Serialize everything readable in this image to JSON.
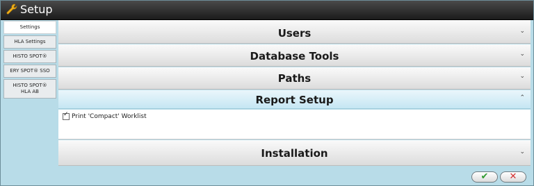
{
  "window": {
    "title": "Setup",
    "icon": "wrench-icon"
  },
  "tabs": [
    {
      "label": "Settings",
      "active": true
    },
    {
      "label": "HLA Settings",
      "active": false
    },
    {
      "label": "HISTO SPOT®",
      "active": false
    },
    {
      "label": "ERY SPOT® SSO",
      "active": false
    },
    {
      "label": "HISTO SPOT®\nHLA AB",
      "active": false
    }
  ],
  "sections": [
    {
      "title": "Users",
      "expanded": false
    },
    {
      "title": "Database Tools",
      "expanded": false
    },
    {
      "title": "Paths",
      "expanded": false
    },
    {
      "title": "Report Setup",
      "expanded": true
    },
    {
      "title": "Installation",
      "expanded": false
    }
  ],
  "report_setup": {
    "option_label": "Print 'Compact' Worklist",
    "checked": true
  },
  "glyphs": {
    "collapsed": "⌄",
    "expanded": "⌃",
    "ok": "✔",
    "cancel": "✕"
  },
  "colors": {
    "background": "#b8dce8",
    "titlebar": "#1b1b1b",
    "ok": "#2f9a2f",
    "cancel": "#d43030"
  }
}
